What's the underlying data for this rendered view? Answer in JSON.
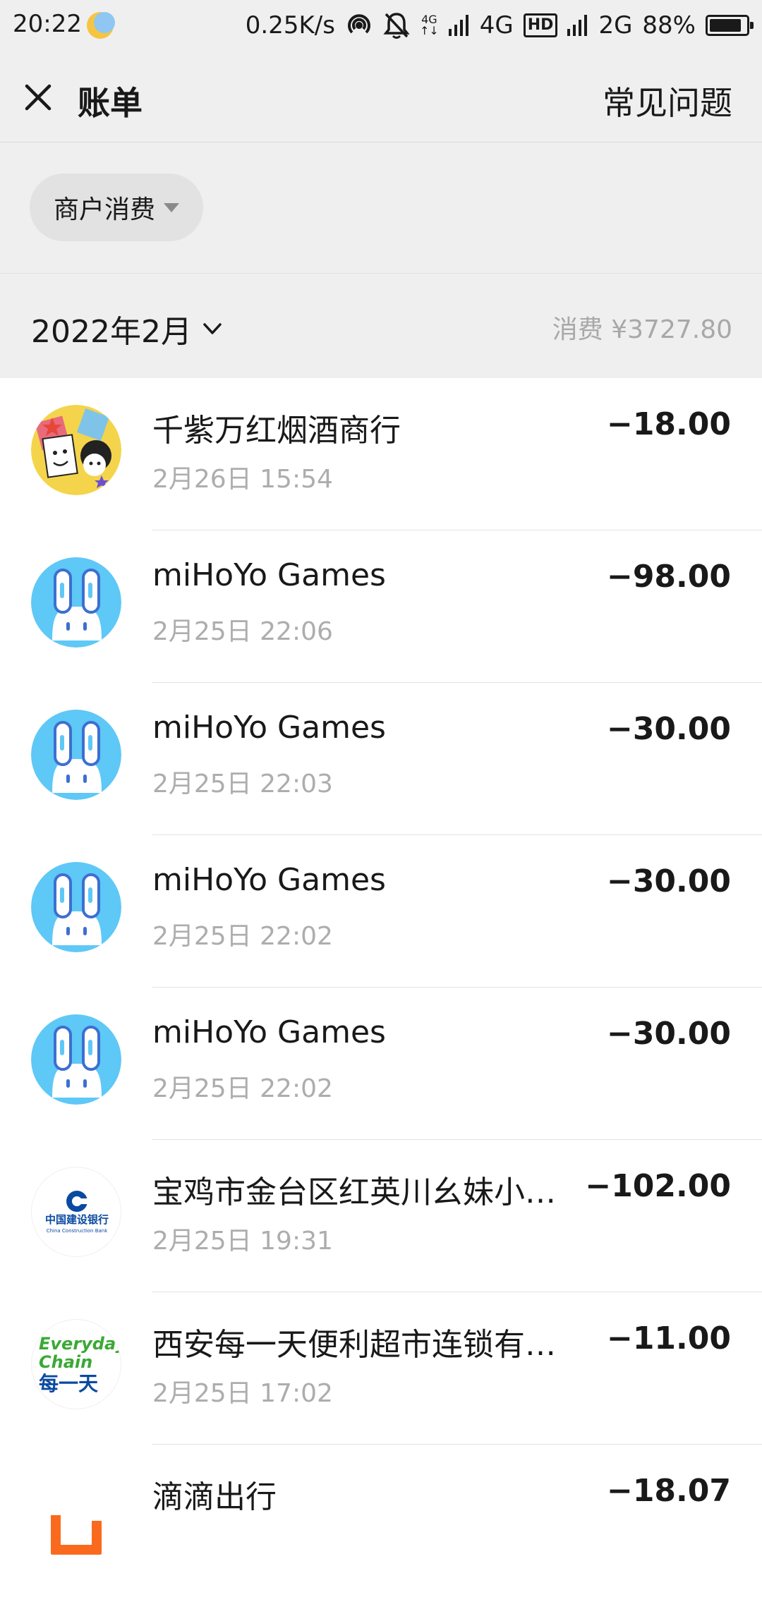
{
  "status_bar": {
    "time": "20:22",
    "net_speed": "0.25K/s",
    "net4g_top": "4G",
    "net4g_bottom": "↑↓",
    "sim1_label": "4G",
    "hd_label": "HD",
    "sim2_label": "2G",
    "battery_text": "88%",
    "battery_level": 0.88
  },
  "nav": {
    "title": "账单",
    "faq_label": "常见问题"
  },
  "filter": {
    "label": "商户消费"
  },
  "month": {
    "label": "2022年2月",
    "total": "消费 ¥3727.80"
  },
  "transactions": [
    {
      "name": "千紫万红烟酒商行",
      "time": "2月26日 15:54",
      "amount": "−18.00",
      "icon": "colorful-shop-avatar"
    },
    {
      "name": "miHoYo Games",
      "time": "2月25日 22:06",
      "amount": "−98.00",
      "icon": "mihoyo-avatar"
    },
    {
      "name": "miHoYo Games",
      "time": "2月25日 22:03",
      "amount": "−30.00",
      "icon": "mihoyo-avatar"
    },
    {
      "name": "miHoYo Games",
      "time": "2月25日 22:02",
      "amount": "−30.00",
      "icon": "mihoyo-avatar"
    },
    {
      "name": "miHoYo Games",
      "time": "2月25日 22:02",
      "amount": "−30.00",
      "icon": "mihoyo-avatar"
    },
    {
      "name": "宝鸡市金台区红英川幺妹小…",
      "time": "2月25日 19:31",
      "amount": "−102.00",
      "icon": "ccb-bank-avatar",
      "logo_text": "中国建设银行",
      "logo_sub": "China Construction Bank"
    },
    {
      "name": "西安每一天便利超市连锁有…",
      "time": "2月25日 17:02",
      "amount": "−11.00",
      "icon": "everyday-chain-avatar",
      "logo_line1": "Everyday",
      "logo_line2": "Chain",
      "logo_line3": "每一天"
    },
    {
      "name": "滴滴出行",
      "time": "",
      "amount": "−18.07",
      "icon": "didi-avatar"
    }
  ],
  "colors": {
    "header_bg": "#efefef",
    "mihoyo_blue": "#5ec8f7",
    "didi_orange": "#fa6a1e",
    "ccb_blue": "#0a4aa0",
    "everyday_green": "#3aa935"
  }
}
